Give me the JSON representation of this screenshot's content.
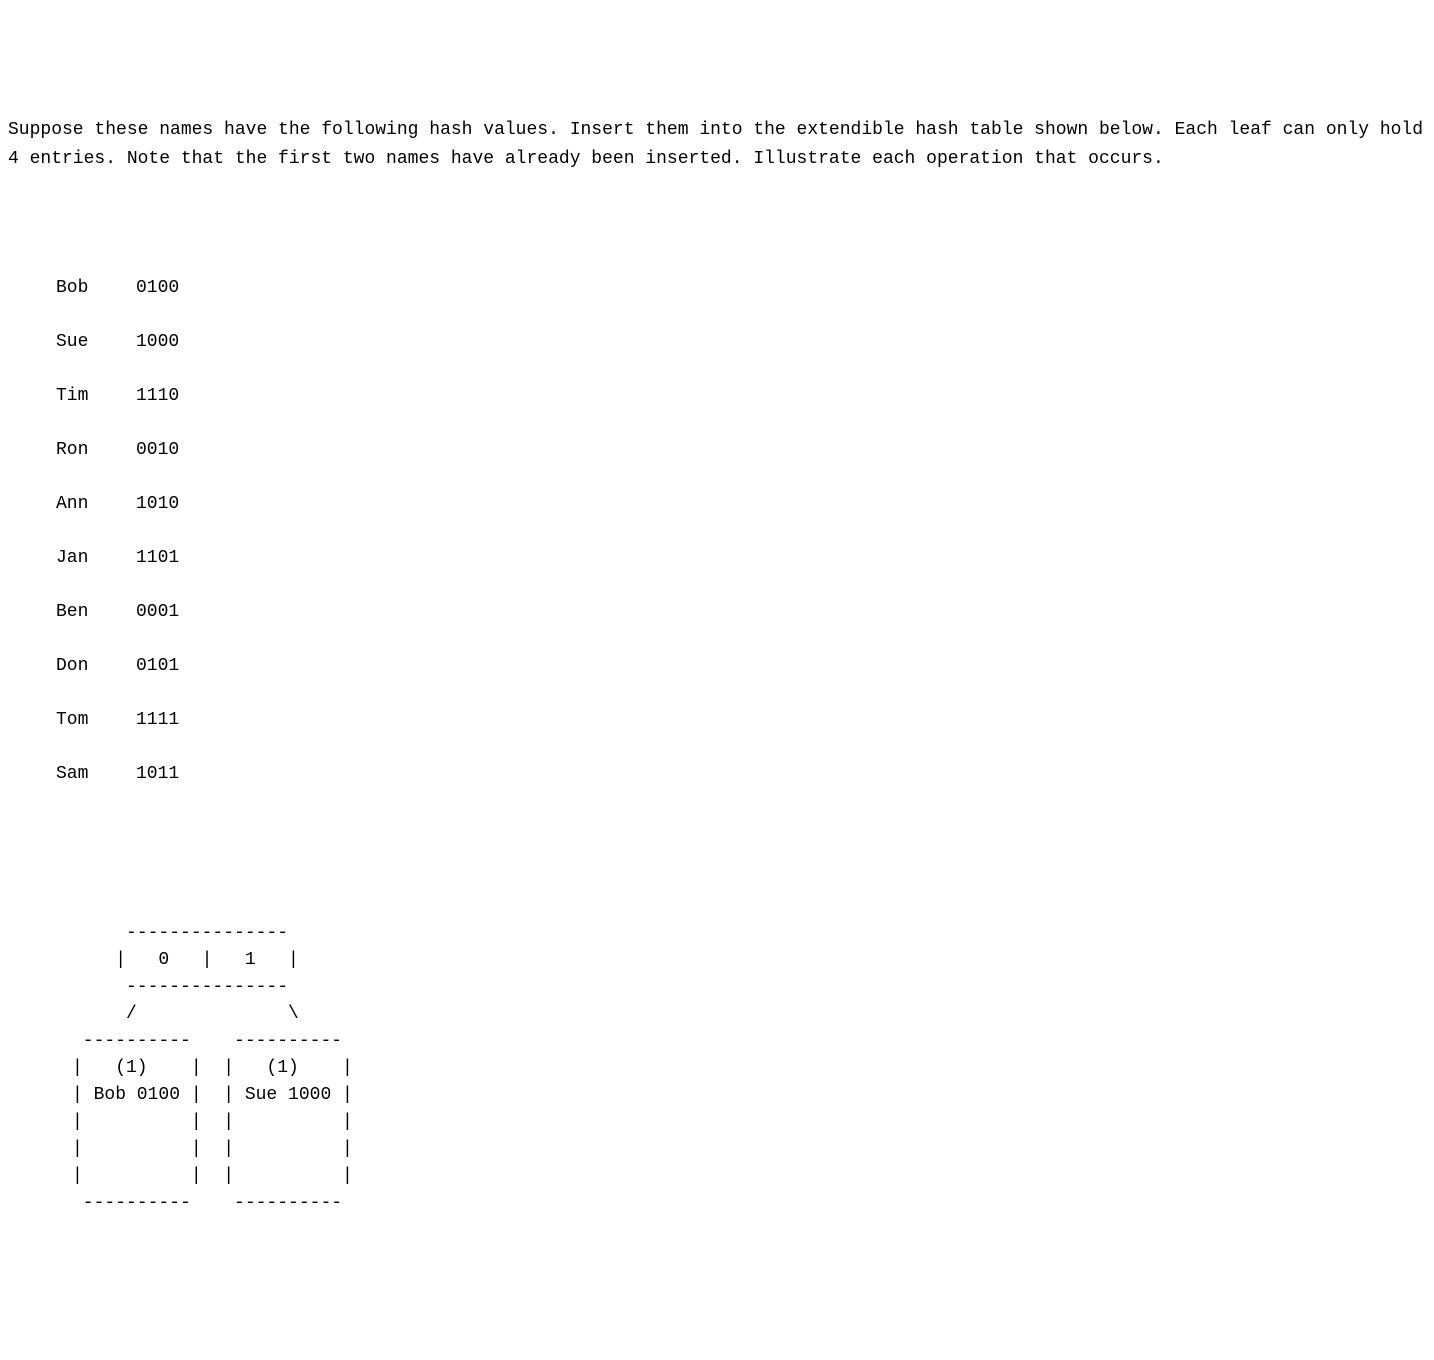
{
  "problem_text": "Suppose these names have the following hash values.  Insert them into the extendible hash table shown below.  Each leaf can only hold 4 entries.  Note that the first two names have already been inserted.  Illustrate each operation that occurs.",
  "hash_entries": [
    {
      "name": "Bob",
      "value": "0100"
    },
    {
      "name": "Sue",
      "value": "1000"
    },
    {
      "name": "Tim",
      "value": "1110"
    },
    {
      "name": "Ron",
      "value": "0010"
    },
    {
      "name": "Ann",
      "value": "1010"
    },
    {
      "name": "Jan",
      "value": "1101"
    },
    {
      "name": "Ben",
      "value": "0001"
    },
    {
      "name": "Don",
      "value": "0101"
    },
    {
      "name": "Tom",
      "value": "1111"
    },
    {
      "name": "Sam",
      "value": "1011"
    }
  ],
  "diagram": {
    "directory": {
      "slots": [
        "0",
        "1"
      ]
    },
    "leaves": [
      {
        "local_depth": "(1)",
        "entries": [
          "Bob 0100"
        ]
      },
      {
        "local_depth": "(1)",
        "entries": [
          "Sue 1000"
        ]
      }
    ]
  },
  "diagram_lines": {
    "l1": "     ---------------",
    "l2": "    |   0   |   1   |",
    "l3": "     ---------------",
    "l4": "     /              \\",
    "l5": " ----------    ----------",
    "l6": "|   (1)    |  |   (1)    |",
    "l7": "| Bob 0100 |  | Sue 1000 |",
    "l8": "|          |  |          |",
    "l9": "|          |  |          |",
    "l10": "|          |  |          |",
    "l11": " ----------    ----------"
  }
}
